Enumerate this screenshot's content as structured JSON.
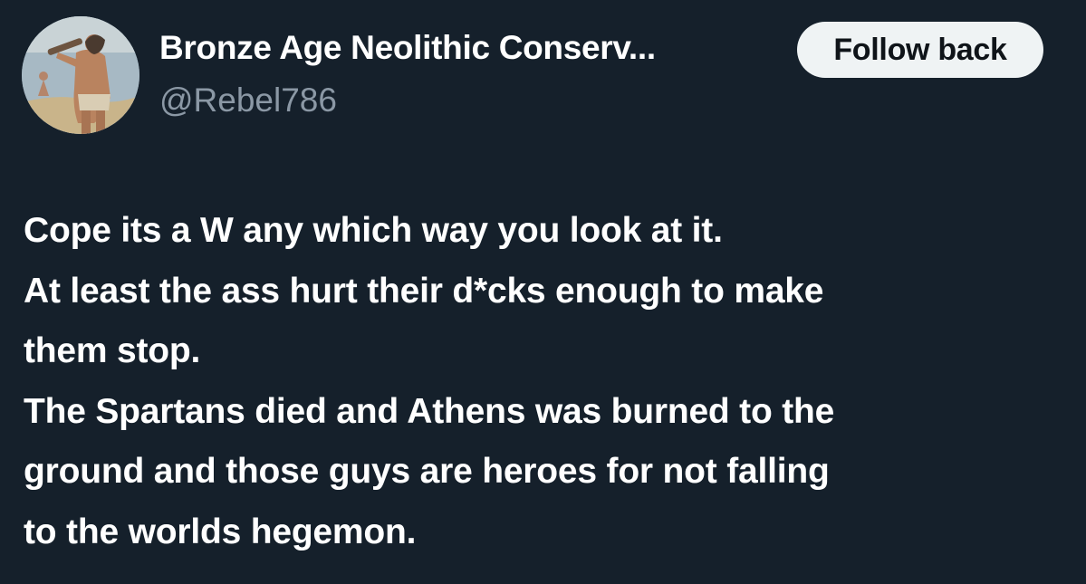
{
  "tweet": {
    "author": {
      "display_name": "Bronze Age Neolithic Conserv...",
      "handle": "@Rebel786",
      "avatar_icon": "classical-painting-avatar"
    },
    "follow_button_label": "Follow back",
    "text_lines": [
      "Cope its a W any which way you look at it.",
      "At least the ass hurt their d*cks enough to make",
      "them stop.",
      "The Spartans died and Athens was burned to the",
      "ground and those guys are heroes for not falling",
      "to the worlds hegemon."
    ]
  },
  "colors": {
    "background": "#15202b",
    "primary_text": "#ffffff",
    "secondary_text": "#8b98a5",
    "button_bg": "#eff3f4",
    "button_text": "#0f1419"
  }
}
